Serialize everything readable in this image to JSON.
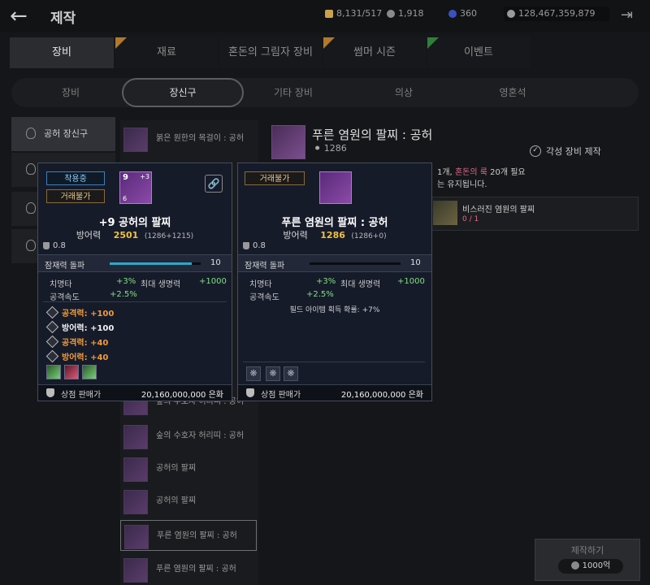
{
  "header": {
    "title": "제작",
    "currencies": [
      "8,131/517",
      "1,918",
      "360",
      "128,467,359,879"
    ]
  },
  "main_tabs": [
    "장비",
    "재료",
    "혼돈의 그림자 장비",
    "썸머 시즌",
    "이벤트"
  ],
  "sub_tabs": [
    "장비",
    "장신구",
    "기타 장비",
    "의상",
    "영혼석"
  ],
  "categories": [
    "공허 장신구"
  ],
  "list": [
    "붉은 원한의 목걸이 : 공허",
    "숲의 수호자 허리띠 : 공허",
    "숲의 수호자 허리띠 : 공허",
    "공허의 팔찌",
    "공허의 팔찌",
    "푸른 염원의 팔찌 : 공허",
    "푸른 염원의 팔찌 : 공허"
  ],
  "detail": {
    "name": "푸른 염원의 팔찌 : 공허",
    "power": "1286",
    "awaken": "각성 장비 제작",
    "desc_1": "1개,",
    "desc_pink": "혼돈의 룩",
    "desc_1b": "20개 필요",
    "desc_2": "는 유지됩니다.",
    "material_name": "비스러진 염원의 팔찌",
    "material_count": "0 / 1",
    "craft_label": "제작하기",
    "craft_cost": "1000억"
  },
  "card_left": {
    "badge_equipped": "착용중",
    "badge_trade": "거래불가",
    "enh_top": "9",
    "enh_plus": "+3",
    "enh_bottom": "6",
    "name": "+9 공허의 팔찌",
    "defense_label": "방어력",
    "defense_value": "2501",
    "defense_detail": "(1286+1215)",
    "weight": "0.8",
    "potential_label": "잠재력 돌파",
    "potential_value": "10",
    "potential_pct": 0.9,
    "crit_label": "치명타",
    "crit_value": "+3%",
    "hp_label": "최대 생명력",
    "hp_value": "+1000",
    "aspd_label": "공격속도",
    "aspd_value": "+2.5%",
    "options": [
      "공격력: +100",
      "방어력: +100",
      "공격력: +40",
      "방어력: +40"
    ],
    "sell_label": "상점 판매가",
    "sell_value": "20,160,000,000 은화"
  },
  "card_right": {
    "badge_trade": "거래불가",
    "name": "푸른 염원의 팔찌 : 공허",
    "defense_label": "방어력",
    "defense_value": "1286",
    "defense_detail": "(1286+0)",
    "weight": "0.8",
    "potential_label": "잠재력 돌파",
    "potential_value": "10",
    "potential_pct": 0.0,
    "crit_label": "치명타",
    "crit_value": "+3%",
    "hp_label": "최대 생명력",
    "hp_value": "+1000",
    "aspd_label": "공격속도",
    "aspd_value": "+2.5%",
    "drop_label": "필드 아이템 획득 확률: +7%",
    "sell_label": "상점 판매가",
    "sell_value": "20,160,000,000 은화"
  },
  "colors": {
    "accent": "#2aa8c8",
    "gold": "#f0c040",
    "green": "#7fe07f",
    "orange": "#f09a3a",
    "pink": "#e06b8a"
  }
}
